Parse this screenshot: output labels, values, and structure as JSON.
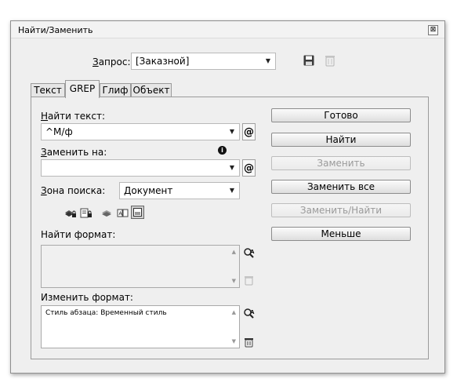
{
  "window": {
    "title": "Найти/Заменить",
    "close_glyph": "⊠"
  },
  "query": {
    "label_underlined": "З",
    "label_rest": "апрос:",
    "value": "[Заказной]"
  },
  "tabs": [
    {
      "label": "Текст"
    },
    {
      "label": "GREP",
      "active": true
    },
    {
      "label": "Глиф"
    },
    {
      "label": "Объект"
    }
  ],
  "find": {
    "label_underlined": "Н",
    "label_rest": "айти текст:",
    "value": "^M/ф"
  },
  "replace": {
    "label_underlined": "З",
    "label_rest": "аменить на:",
    "value": ""
  },
  "search_zone": {
    "label_underlined": "З",
    "label_rest": "она поиска:",
    "value": "Документ"
  },
  "find_format": {
    "label": "Найти формат:",
    "value": ""
  },
  "change_format": {
    "label": "Изменить формат:",
    "value": "Стиль абзаца: Временный стиль"
  },
  "buttons": {
    "done": "Готово",
    "find": "Найти",
    "replace": "Заменить",
    "replace_all": "Заменить все",
    "replace_find": "Заменить/Найти",
    "fewer": "Меньше"
  },
  "icons": {
    "at": "@",
    "info": "i",
    "dropdown_arrow": "▼",
    "scroll_up": "▲",
    "scroll_down": "▼"
  }
}
